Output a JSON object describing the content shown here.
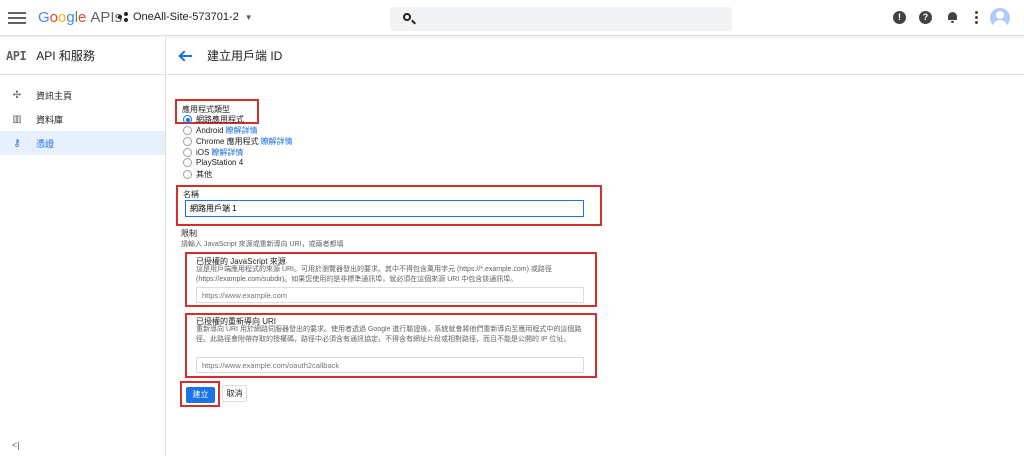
{
  "topbar": {
    "logo_google": "Google",
    "logo_apis": "APIs",
    "project_name": "OneAll-Site-573701-2",
    "alert_icon_glyph": "!",
    "help_icon_glyph": "?"
  },
  "sidebar": {
    "title": "API 和服務",
    "logo": "API",
    "items": [
      {
        "label": "資訊主頁",
        "icon": "dashboard-icon",
        "glyph": "✣"
      },
      {
        "label": "資料庫",
        "icon": "library-icon",
        "glyph": "▥"
      },
      {
        "label": "憑證",
        "icon": "key-icon",
        "glyph": "⚷"
      }
    ],
    "collapse_glyph": "<|"
  },
  "page": {
    "title": "建立用戶端 ID"
  },
  "form": {
    "app_type_label": "應用程式類型",
    "app_types": [
      {
        "label": "網路應用程式",
        "link": "",
        "checked": true
      },
      {
        "label": "Android",
        "link": "瞭解詳情",
        "checked": false
      },
      {
        "label": "Chrome 應用程式",
        "link": "瞭解詳情",
        "checked": false
      },
      {
        "label": "iOS",
        "link": "瞭解詳情",
        "checked": false
      },
      {
        "label": "PlayStation 4",
        "link": "",
        "checked": false
      },
      {
        "label": "其他",
        "link": "",
        "checked": false
      }
    ],
    "name_label": "名稱",
    "name_value": "網路用戶端 1",
    "restrictions_label": "限制",
    "restrictions_help": "請輸入 JavaScript 來源或重新導向 URI，或兩者都填",
    "js_origins": {
      "label": "已授權的 JavaScript 來源",
      "help": "這是用戶端應用程式的來源 URI。可用於瀏覽器發出的要求。其中不得包含萬用字元 (https://*.example.com) 或路徑 (https://example.com/subdir)。如果您使用的是非標準通訊埠，就必須在這個來源 URI 中包含該通訊埠。",
      "placeholder": "https://www.example.com"
    },
    "redirect_uris": {
      "label": "已授權的重新導向 URI",
      "help": "重新導向 URI 用於網路伺服器發出的要求。使用者透過 Google 進行驗證後，系統就會將他們重新導向至應用程式中的這個路徑。此路徑會附帶存取的授權碼，路徑中必須含有通訊協定，不得含有網址片段或相對路徑，而且不能是公開的 IP 位址。",
      "placeholder": "https://www.example.com/oauth2callback"
    },
    "create_label": "建立",
    "cancel_label": "取消"
  },
  "colors": {
    "accent": "#1a73e8",
    "highlight": "#d32f2f"
  }
}
